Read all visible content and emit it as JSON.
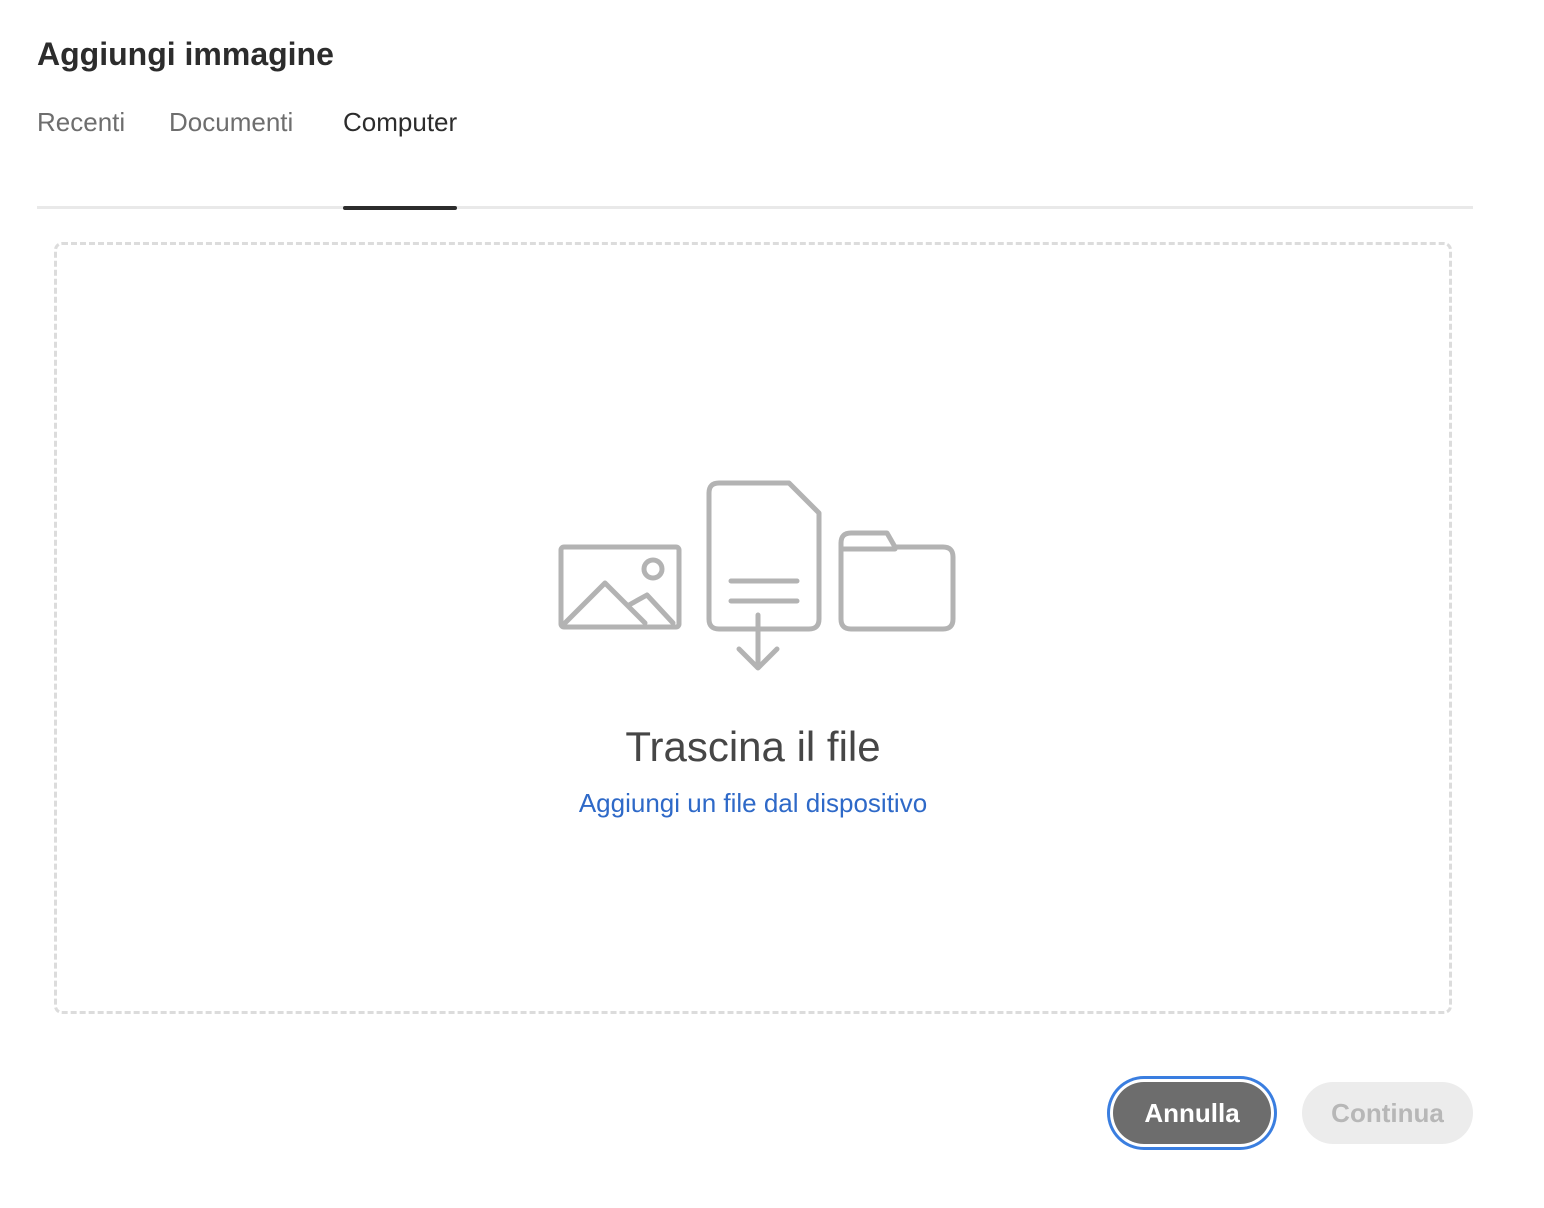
{
  "dialog": {
    "title": "Aggiungi immagine"
  },
  "tabs": [
    {
      "label": "Recenti",
      "selected": false
    },
    {
      "label": "Documenti",
      "selected": false
    },
    {
      "label": "Computer",
      "selected": true
    }
  ],
  "dropzone": {
    "heading": "Trascina il file",
    "link_label": "Aggiungi un file dal dispositivo",
    "icons": [
      "image-icon",
      "document-download-icon",
      "folder-icon"
    ]
  },
  "footer": {
    "cancel_label": "Annulla",
    "continue_label": "Continua",
    "continue_disabled": true
  },
  "colors": {
    "link": "#2e69c8",
    "focus_ring": "#3a7ee0",
    "cancel_bg": "#6d6d6d",
    "continue_bg": "#ececec",
    "icon_stroke": "#b3b3b3"
  }
}
